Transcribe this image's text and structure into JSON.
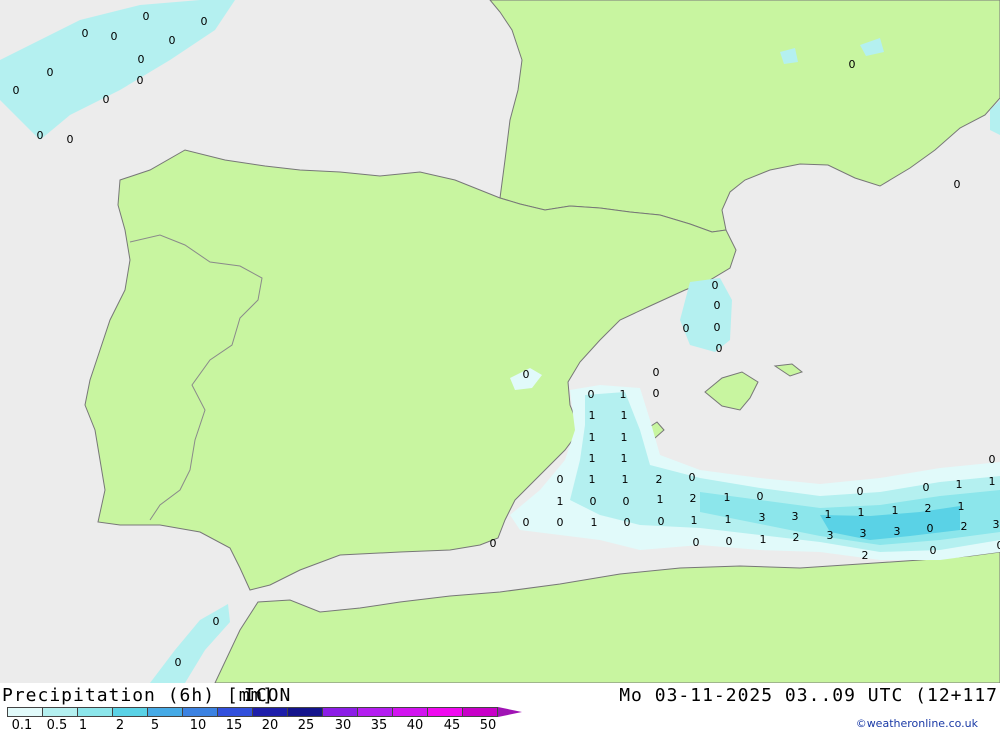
{
  "map": {
    "colors": {
      "sea": "#ececec",
      "land": "#c8f5a0",
      "border": "#8a8a8a",
      "coast": "#777777"
    },
    "labels": [
      {
        "v": "0"
      },
      {
        "v": "0"
      },
      {
        "v": "0"
      },
      {
        "v": "0"
      },
      {
        "v": "0"
      },
      {
        "v": "0"
      },
      {
        "v": "0"
      },
      {
        "v": "0"
      },
      {
        "v": "0"
      },
      {
        "v": "0"
      },
      {
        "v": "0"
      },
      {
        "v": "0"
      },
      {
        "v": "0"
      },
      {
        "v": "0"
      },
      {
        "v": "0"
      },
      {
        "v": "0"
      },
      {
        "v": "0"
      },
      {
        "v": "0"
      },
      {
        "v": "0"
      },
      {
        "v": "0"
      },
      {
        "v": "0"
      },
      {
        "v": "0"
      },
      {
        "v": "0"
      },
      {
        "v": "0"
      },
      {
        "v": "1"
      },
      {
        "v": "1"
      },
      {
        "v": "1"
      },
      {
        "v": "1"
      },
      {
        "v": "1"
      },
      {
        "v": "1"
      },
      {
        "v": "1"
      },
      {
        "v": "0"
      },
      {
        "v": "1"
      },
      {
        "v": "1"
      },
      {
        "v": "2"
      },
      {
        "v": "0"
      },
      {
        "v": "1"
      },
      {
        "v": "0"
      },
      {
        "v": "0"
      },
      {
        "v": "1"
      },
      {
        "v": "2"
      },
      {
        "v": "1"
      },
      {
        "v": "0"
      },
      {
        "v": "0"
      },
      {
        "v": "0"
      },
      {
        "v": "0"
      },
      {
        "v": "1"
      },
      {
        "v": "0"
      },
      {
        "v": "0"
      },
      {
        "v": "1"
      },
      {
        "v": "1"
      },
      {
        "v": "3"
      },
      {
        "v": "3"
      },
      {
        "v": "1"
      },
      {
        "v": "1"
      },
      {
        "v": "1"
      },
      {
        "v": "2"
      },
      {
        "v": "1"
      },
      {
        "v": "0"
      },
      {
        "v": "0"
      },
      {
        "v": "0"
      },
      {
        "v": "1"
      },
      {
        "v": "2"
      },
      {
        "v": "3"
      },
      {
        "v": "3"
      },
      {
        "v": "3"
      },
      {
        "v": "0"
      },
      {
        "v": "2"
      },
      {
        "v": "3"
      },
      {
        "v": "0"
      },
      {
        "v": "1"
      },
      {
        "v": "1"
      },
      {
        "v": "2"
      },
      {
        "v": "0"
      },
      {
        "v": "0"
      },
      {
        "v": "0"
      },
      {
        "v": "0"
      }
    ]
  },
  "footer": {
    "title": "Precipitation (6h) [mm]",
    "model": "ICON",
    "datetime": "Mo 03-11-2025 03..09 UTC (12+117",
    "credit": "©weatheronline.co.uk"
  },
  "legend": {
    "colors": [
      "#e1fafa",
      "#b4f0f0",
      "#8ce6eb",
      "#5ad2e6",
      "#46aae6",
      "#3c82e1",
      "#3250dc",
      "#1e1eaa",
      "#14148c",
      "#8c1ee6",
      "#b41ef0",
      "#d214f0",
      "#f00af0",
      "#c800c8"
    ],
    "arrow_color": "#a014b4",
    "ticks": [
      "0.1",
      "0.5",
      "1",
      "2",
      "5",
      "10",
      "15",
      "20",
      "25",
      "30",
      "35",
      "40",
      "45",
      "50"
    ]
  }
}
